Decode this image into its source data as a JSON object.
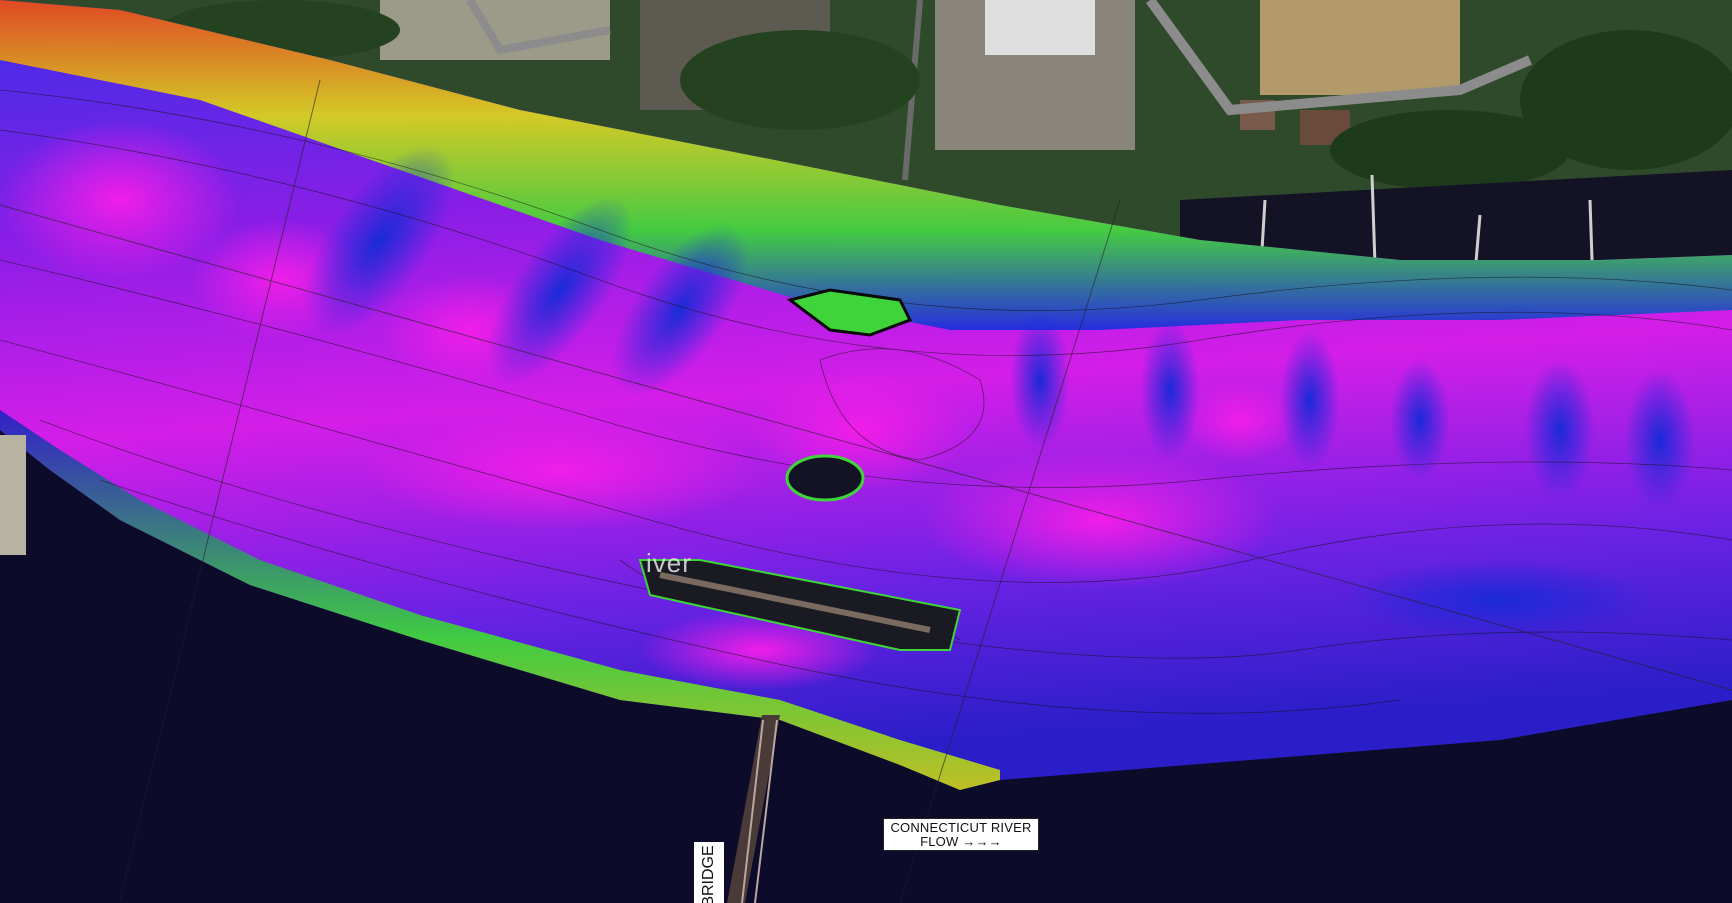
{
  "map": {
    "flow_label_line1": "CONNECTICUT RIVER",
    "flow_label_line2": "FLOW →→→",
    "bridge_label": "BRIDGE",
    "basemap_river_label": "iver"
  },
  "legend_colors": {
    "shallow": "#e84a1a",
    "mid_shallow": "#3fd43a",
    "mid": "#1f2de0",
    "deep": "#e01ee6",
    "water_dark": "#0c0b2a",
    "vegetation": "#2b5a26"
  }
}
